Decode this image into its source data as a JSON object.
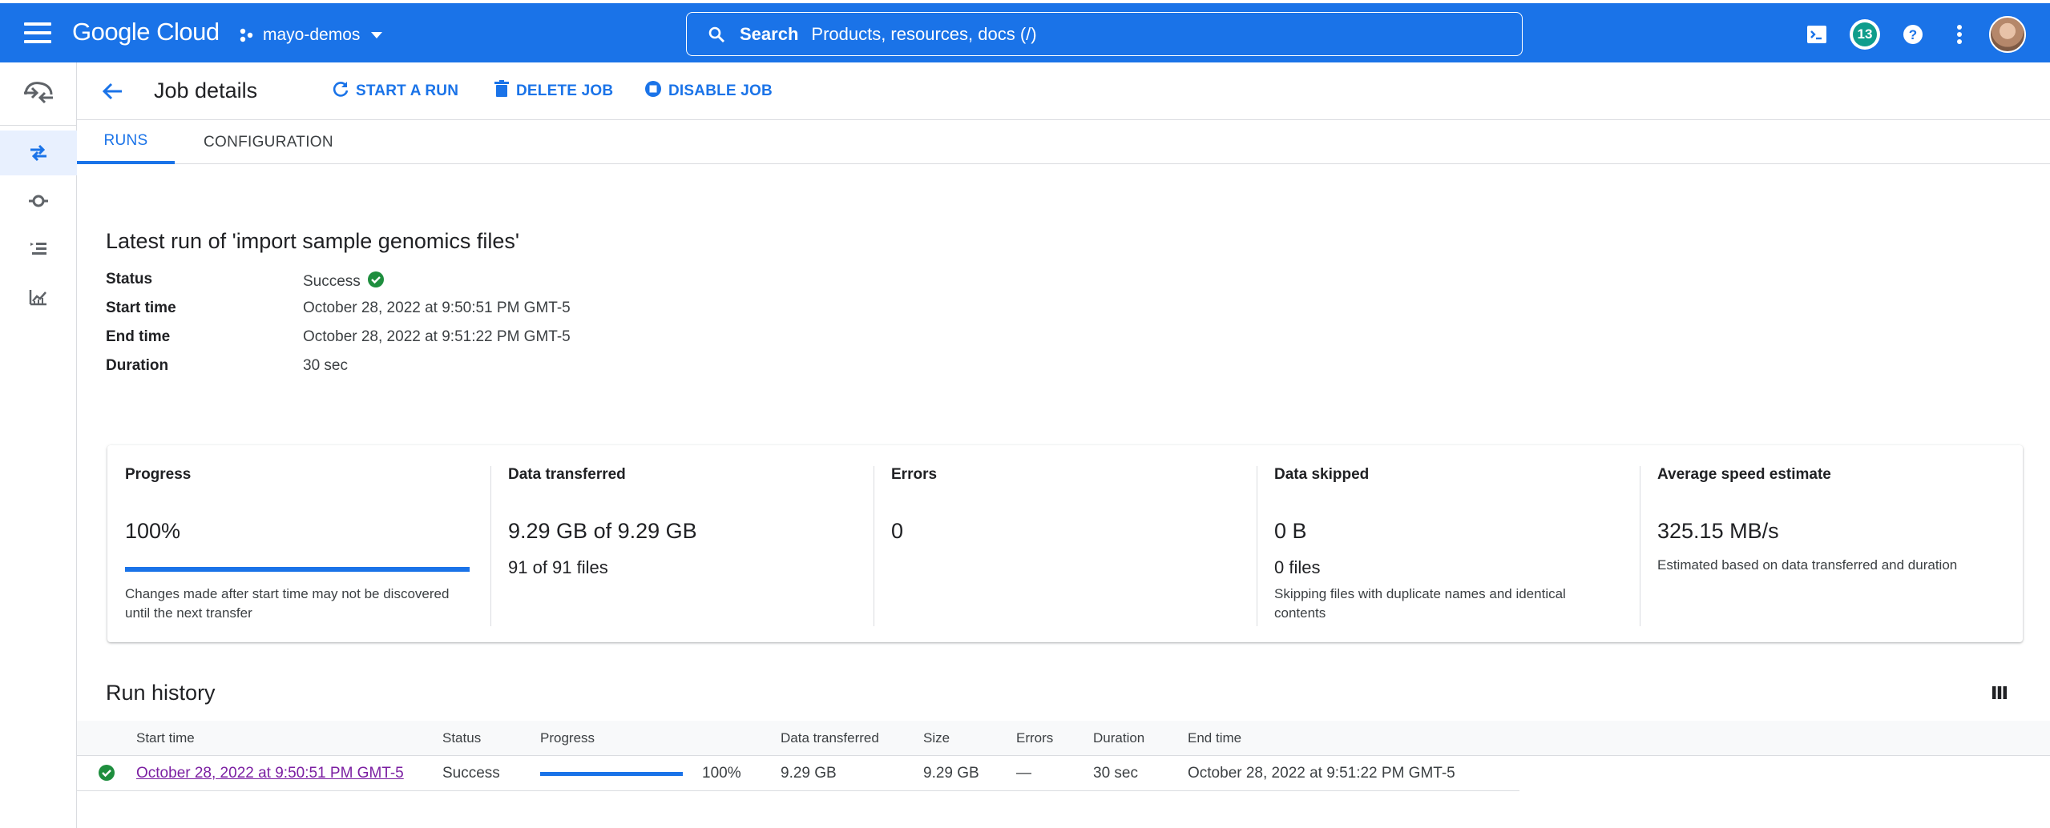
{
  "topbar": {
    "logo": "Google Cloud",
    "project": "mayo-demos",
    "search_label": "Search",
    "search_placeholder": "Products, resources, docs (/)",
    "notifications_count": "13"
  },
  "header": {
    "title": "Job details",
    "actions": [
      "START A RUN",
      "DELETE JOB",
      "DISABLE JOB"
    ]
  },
  "tabs": [
    {
      "label": "RUNS",
      "active": true
    },
    {
      "label": "CONFIGURATION",
      "active": false
    }
  ],
  "latest_run": {
    "title": "Latest run of 'import sample genomics files'",
    "rows": [
      {
        "label": "Status",
        "value": "Success"
      },
      {
        "label": "Start time",
        "value": "October 28, 2022 at 9:50:51 PM GMT-5"
      },
      {
        "label": "End time",
        "value": "October 28, 2022 at 9:51:22 PM GMT-5"
      },
      {
        "label": "Duration",
        "value": "30 sec"
      }
    ]
  },
  "stats": {
    "progress": {
      "label": "Progress",
      "value": "100%",
      "fraction": 1.0,
      "note": "Changes made after start time may not be discovered until the next transfer"
    },
    "data_transferred": {
      "label": "Data transferred",
      "value": "9.29 GB of 9.29 GB",
      "sub": "91 of 91 files"
    },
    "errors": {
      "label": "Errors",
      "value": "0"
    },
    "data_skipped": {
      "label": "Data skipped",
      "value": "0 B",
      "sub": "0 files",
      "note": "Skipping files with duplicate names and identical contents"
    },
    "speed": {
      "label": "Average speed estimate",
      "value": "325.15 MB/s",
      "note": "Estimated based on data transferred and duration"
    }
  },
  "run_history": {
    "title": "Run history",
    "columns": [
      "Start time",
      "Status",
      "Progress",
      "Data transferred",
      "Size",
      "Errors",
      "Duration",
      "End time"
    ],
    "rows": [
      {
        "start_time": "October 28, 2022 at 9:50:51 PM GMT-5",
        "status": "Success",
        "progress": "100%",
        "progress_fraction": 1.0,
        "data_transferred": "9.29 GB",
        "size": "9.29 GB",
        "errors": "—",
        "duration": "30 sec",
        "end_time": "October 28, 2022 at 9:51:22 PM GMT-5"
      }
    ]
  },
  "colors": {
    "brand": "#1a73e8",
    "success": "#1e8e3e",
    "link_visited": "#7b1fa2"
  },
  "icons": [
    "menu-icon",
    "project-icon",
    "chevron-down-icon",
    "search-icon",
    "cloud-shell-icon",
    "help-icon",
    "more-vert-icon",
    "transfer-logo-icon",
    "transfer-jobs-icon",
    "agent-pools-icon",
    "list-icon",
    "monitoring-icon",
    "arrow-back-icon",
    "refresh-icon",
    "delete-icon",
    "stop-circle-icon",
    "check-circle-icon",
    "column-display-icon"
  ]
}
